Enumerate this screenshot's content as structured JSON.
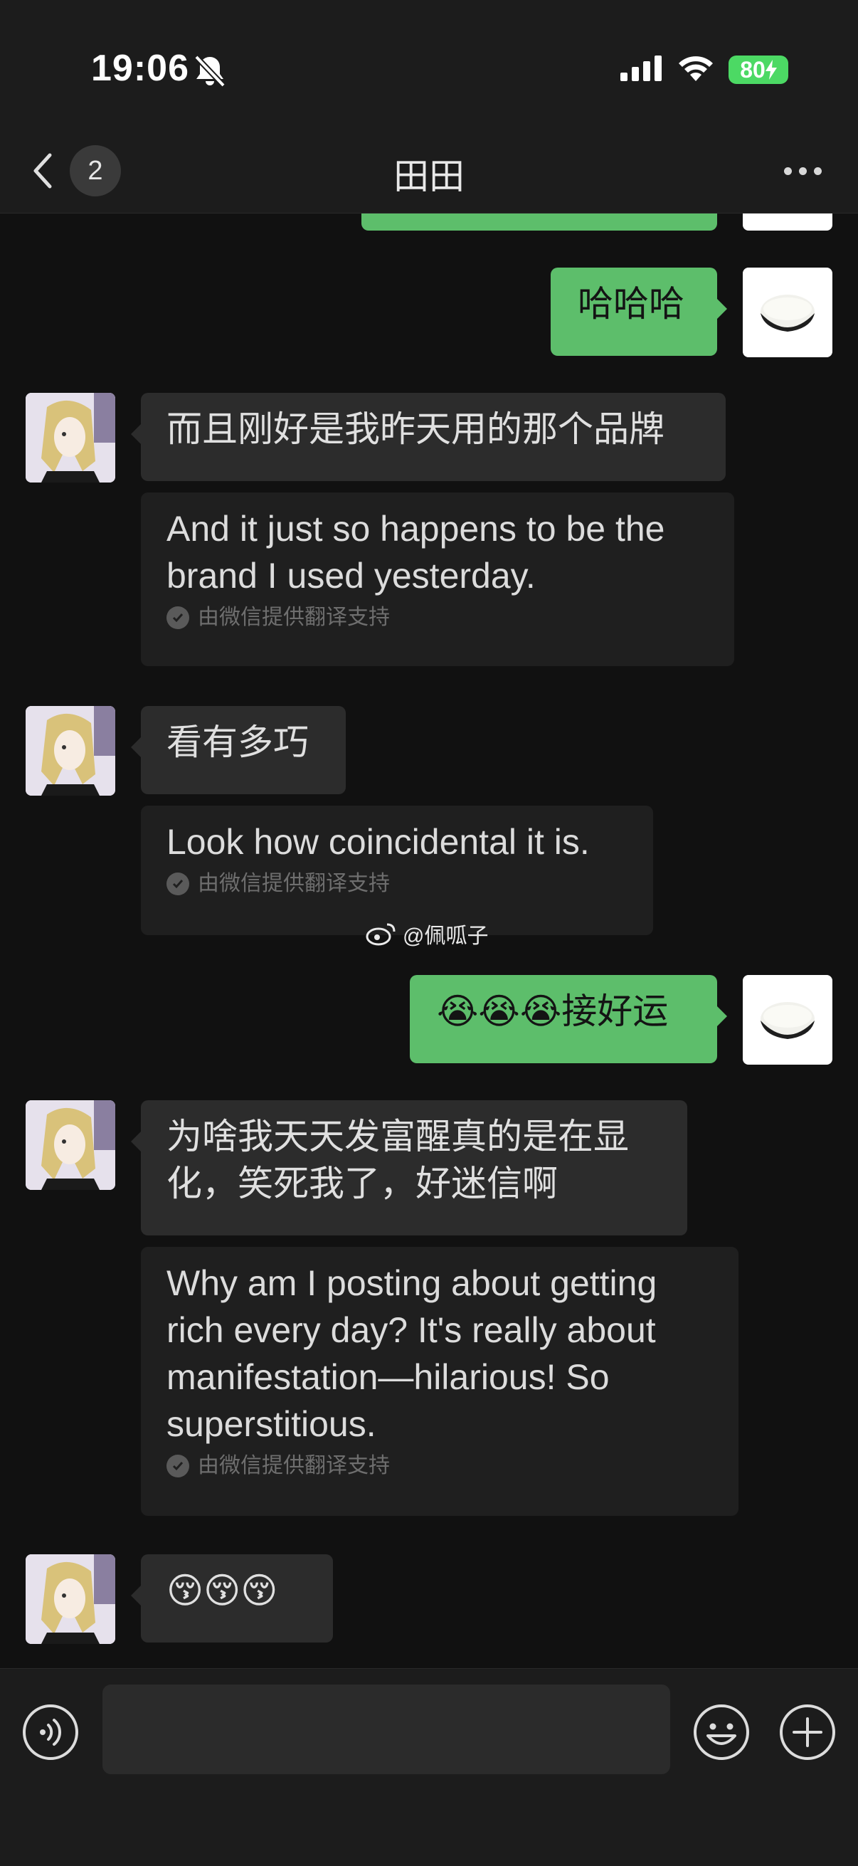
{
  "status_bar": {
    "time": "19:06",
    "battery": "80"
  },
  "nav": {
    "unread_count": "2",
    "title": "田田"
  },
  "messages": [
    {
      "id": "m1",
      "direction": "out",
      "text": "哈哈哈"
    },
    {
      "id": "m2",
      "direction": "in",
      "text": "而且刚好是我昨天用的那个品牌",
      "translation": "And it just so happens to be the brand I used yesterday."
    },
    {
      "id": "m3",
      "direction": "in",
      "text": "看有多巧",
      "translation": "Look how coincidental it is."
    },
    {
      "id": "m4",
      "direction": "out",
      "text": "😭😭😭接好运"
    },
    {
      "id": "m5",
      "direction": "in",
      "text": "为啥我天天发富醒真的是在显化，笑死我了，好迷信啊",
      "translation": "Why am I posting about getting rich every day? It's really about manifestation—hilarious! So superstitious."
    },
    {
      "id": "m6",
      "direction": "in",
      "text": "😚😚😚"
    }
  ],
  "translation_credit": "由微信提供翻译支持",
  "watermark": "@佩呱子",
  "colors": {
    "outgoing_bubble": "#5dbe6b",
    "incoming_bubble": "#2c2c2c",
    "translation_bubble": "#1f1f1f",
    "background": "#111111"
  }
}
